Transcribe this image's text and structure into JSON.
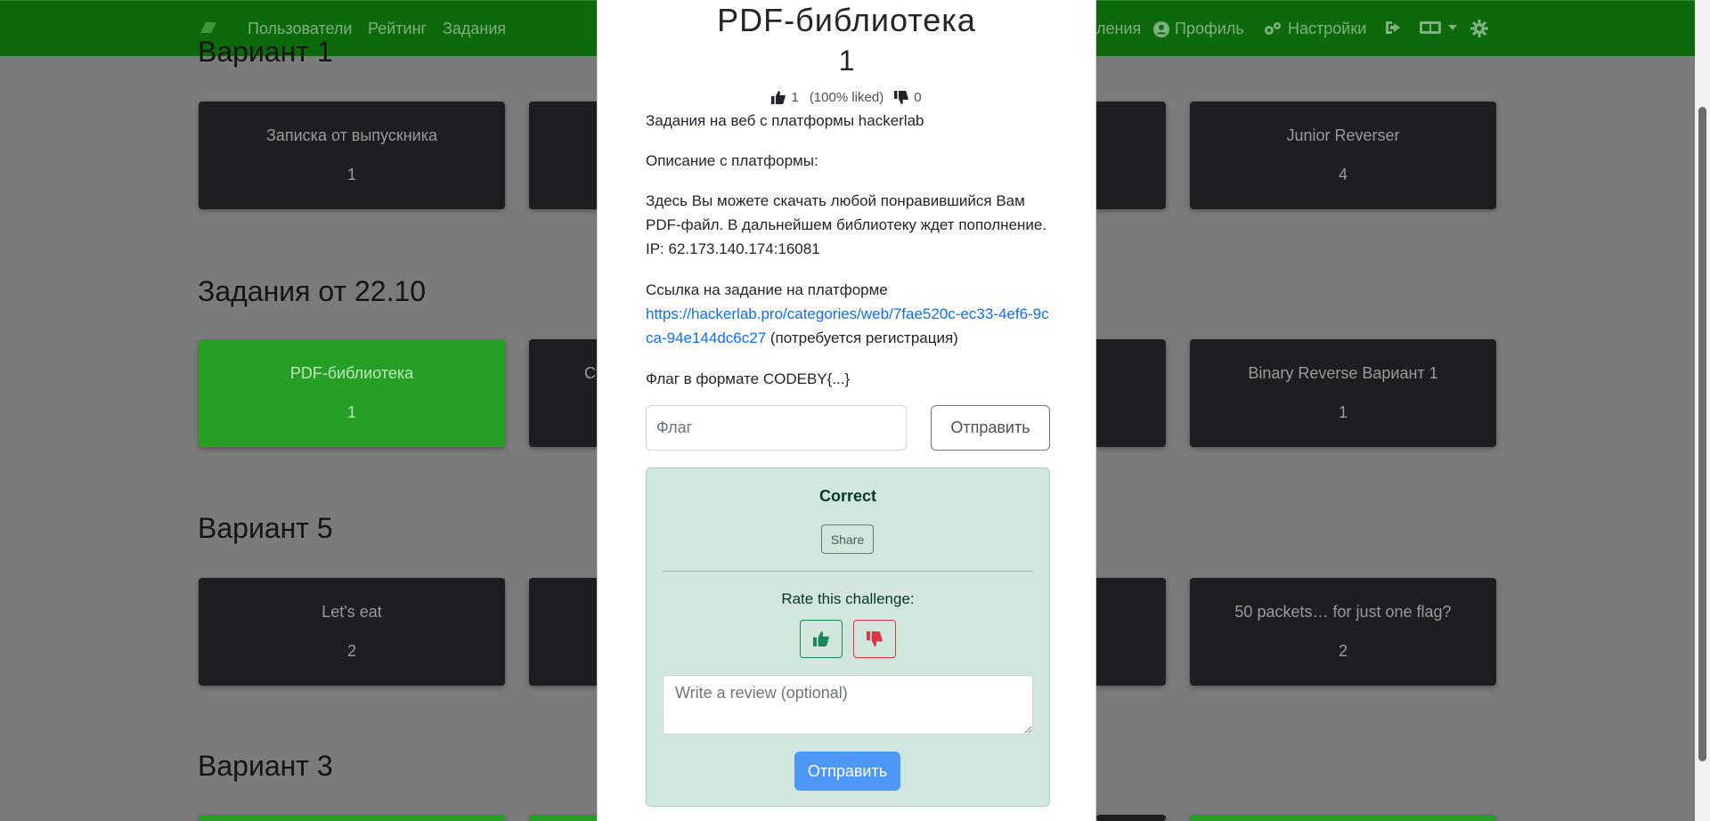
{
  "navbar": {
    "links": [
      "Пользователи",
      "Рейтинг",
      "Задания"
    ],
    "right_partial": "ления",
    "profile": "Профиль",
    "settings": "Настройки",
    "lang_icon": "language-icon",
    "theme_icon": "gear-icon"
  },
  "sections": [
    {
      "title": "Вариант 1"
    },
    {
      "title": "Задания от 22.10"
    },
    {
      "title": "Вариант 5"
    },
    {
      "title": "Вариант 3"
    }
  ],
  "cards": {
    "r1c1": {
      "title": "Записка от выпускника",
      "points": "1"
    },
    "r1c4": {
      "title": "Junior Reverser",
      "points": "4"
    },
    "r2c1": {
      "title": "PDF-библиотека",
      "points": "1"
    },
    "r2c2": {
      "title": "Ст"
    },
    "r2c4": {
      "title": "Binary Reverse Вариант 1",
      "points": "1"
    },
    "r3c1": {
      "title": "Let's eat",
      "points": "2"
    },
    "r3c4": {
      "title": "50 packets… for just one flag?",
      "points": "2"
    }
  },
  "modal": {
    "title": "PDF-библиотека",
    "points": "1",
    "likes": "1",
    "liked_pct": "(100% liked)",
    "dislikes": "0",
    "intro": "Задания на веб с платформы hackerlab",
    "desc_label": "Описание с платформы:",
    "desc": "Здесь Вы можете скачать любой понравившийся Вам PDF-файл. В дальнейшем библиотеку ждет пополнение. IP: 62.173.140.174:16081",
    "link_label": "Ссылка на задание на платформе",
    "link_url": "https://hackerlab.pro/categories/web/7fae520c-ec33-4ef6-9cca-94e144dc6c27",
    "link_note": " (потребуется регистрация)",
    "flag_format": "Флаг в формате CODEBY{...}",
    "flag_placeholder": "Флаг",
    "submit_label": "Отправить",
    "result": {
      "status": "Correct",
      "share_label": "Share",
      "rate_label": "Rate this challenge:",
      "review_placeholder": "Write a review (optional)",
      "send_label": "Отправить"
    }
  },
  "colors": {
    "navbar": "#0c6a0c",
    "solved_card": "#25a025",
    "unsolved_card": "#1e1e22",
    "success_bg": "#d1e7dd",
    "primary": "#4f97f7"
  }
}
